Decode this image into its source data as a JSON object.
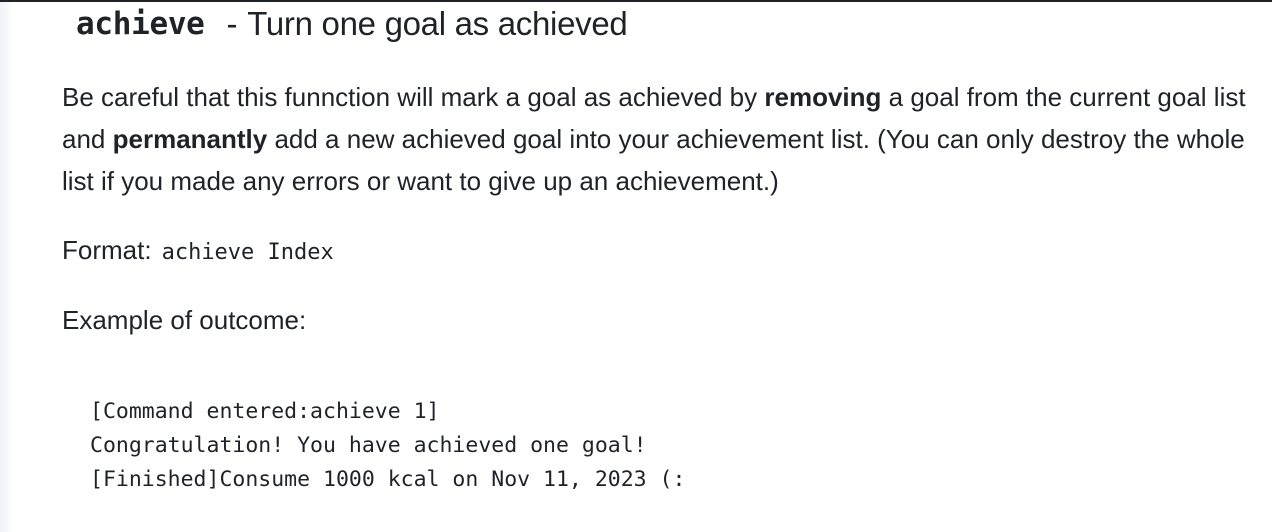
{
  "heading": {
    "command": "achieve",
    "separator": "-",
    "title": "Turn one goal as achieved"
  },
  "description": {
    "part1": "Be careful that this funnction will mark a goal as achieved by ",
    "bold1": "removing",
    "part2": " a goal from the current goal list and ",
    "bold2": "permanantly",
    "part3": " add a new achieved goal into your achievement list. (You can only destroy the whole list if you made any errors or want to give up an achievement.)"
  },
  "format": {
    "label": "Format:",
    "code": "achieve Index"
  },
  "example": {
    "label": "Example of outcome:",
    "lines": [
      "[Command entered:achieve 1]",
      "Congratulation! You have achieved one goal!",
      "[Finished]Consume 1000 kcal on Nov 11, 2023 (:"
    ]
  }
}
